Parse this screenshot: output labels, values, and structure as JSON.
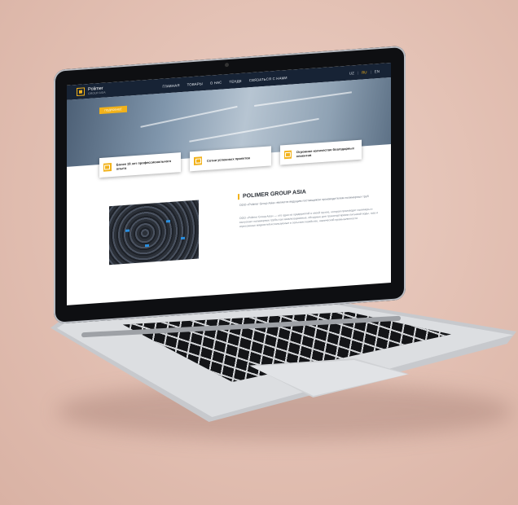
{
  "site": {
    "logo": {
      "name": "Polimer",
      "sub": "GROUP ASIA"
    },
    "nav": [
      "ГЛАВНАЯ",
      "ТОВАРЫ",
      "О НАС",
      "ТЕНДЕ",
      "СВЯЗАТЬСЯ С НАМИ"
    ],
    "langs": {
      "uz": "UZ",
      "ru": "RU",
      "en": "EN",
      "sep": "|"
    },
    "hero_button": "ПОДРОБНЕЕ",
    "cards": [
      {
        "text": "Более 19 лет профессионального опыта"
      },
      {
        "text": "Сотни успешных проектов"
      },
      {
        "text": "Огромное количество благодарных клиентов"
      }
    ],
    "about": {
      "title": "POLIMER GROUP ASIA",
      "subtitle": "ООО «Polimer Group Asia» является ведущим поставщиком производителем полимерных труб",
      "text": "ООО «Polimer Group Asia» — это одно из предприятий в своей группе, которая производит полимеры и выпускает полимерные трубы как канализационные, обсадные для транспортировки питьевой воды, газа и агрессивных жидкостей используемые в сельском хозяйстве, химической промышленности"
    }
  },
  "colors": {
    "accent": "#f2b21a",
    "header": "#172335"
  }
}
